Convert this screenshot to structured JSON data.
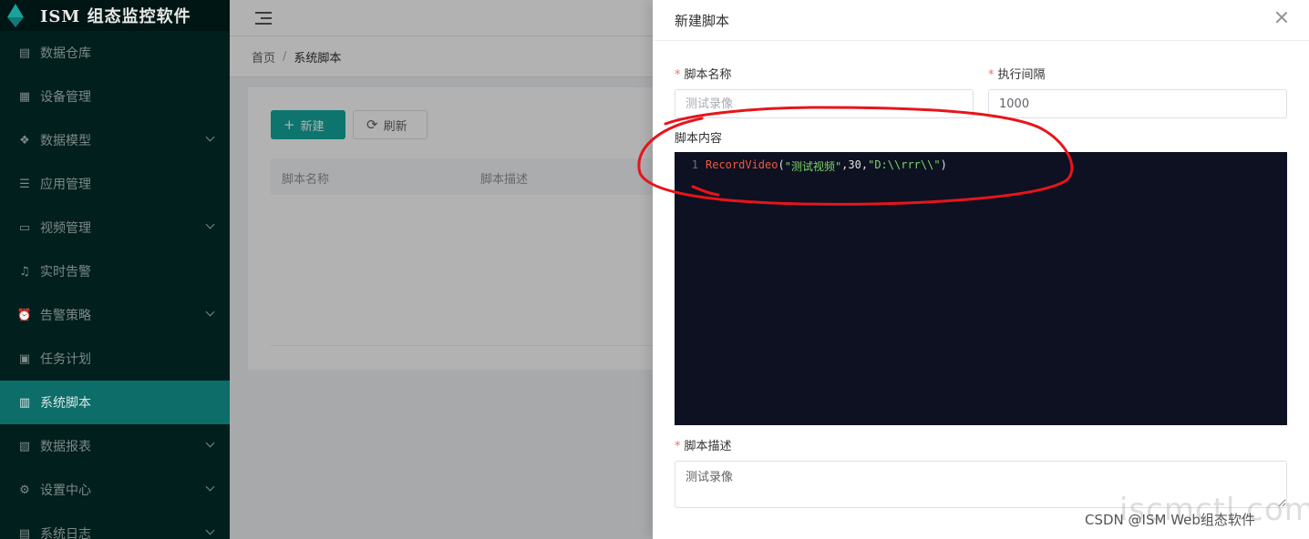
{
  "app": {
    "title": "ISM 组态监控软件"
  },
  "sidebar": {
    "items": [
      {
        "label": "数据仓库",
        "icon": "database-icon",
        "has_children": false,
        "active": false
      },
      {
        "label": "设备管理",
        "icon": "device-icon",
        "has_children": false,
        "active": false
      },
      {
        "label": "数据模型",
        "icon": "dropbox-icon",
        "has_children": true,
        "active": false
      },
      {
        "label": "应用管理",
        "icon": "list-icon",
        "has_children": false,
        "active": false
      },
      {
        "label": "视频管理",
        "icon": "video-icon",
        "has_children": true,
        "active": false
      },
      {
        "label": "实时告警",
        "icon": "bell-icon",
        "has_children": false,
        "active": false
      },
      {
        "label": "告警策略",
        "icon": "alarm-icon",
        "has_children": true,
        "active": false
      },
      {
        "label": "任务计划",
        "icon": "calendar-icon",
        "has_children": false,
        "active": false
      },
      {
        "label": "系统脚本",
        "icon": "script-icon",
        "has_children": false,
        "active": true
      },
      {
        "label": "数据报表",
        "icon": "report-icon",
        "has_children": true,
        "active": false
      },
      {
        "label": "设置中心",
        "icon": "gear-icon",
        "has_children": true,
        "active": false
      },
      {
        "label": "系统日志",
        "icon": "log-icon",
        "has_children": true,
        "active": false
      }
    ]
  },
  "breadcrumb": {
    "home": "首页",
    "separator": "/",
    "current": "系统脚本"
  },
  "toolbar": {
    "new_label": "新建",
    "refresh_label": "刷新"
  },
  "table": {
    "columns": [
      "脚本名称",
      "脚本描述"
    ]
  },
  "drawer": {
    "title": "新建脚本",
    "fields": {
      "name": {
        "label": "脚本名称",
        "required": true,
        "placeholder": "测试录像",
        "value": ""
      },
      "interval": {
        "label": "执行间隔",
        "required": true,
        "value": "1000"
      },
      "content": {
        "label": "脚本内容",
        "line_number": "1",
        "code": {
          "function": "RecordVideo",
          "open_paren": "(",
          "arg1": "\"测试视频\"",
          "comma1": ",",
          "arg2": "30",
          "comma2": ",",
          "arg3": "\"D:\\\\rrr\\\\\"",
          "close_paren": ")"
        }
      },
      "description": {
        "label": "脚本描述",
        "required": true,
        "value": "测试录像"
      }
    },
    "required_mark": "*"
  },
  "colors": {
    "sidebar_bg": "#001f1d",
    "active_item": "#0d6d68",
    "primary": "#13a89e",
    "editor_bg": "#0d1121",
    "annotation_red": "#e8141b",
    "required": "#f56c6c"
  },
  "watermark": {
    "text": "CSDN @ISM Web组态软件",
    "overlay": "iscmctl.com"
  }
}
